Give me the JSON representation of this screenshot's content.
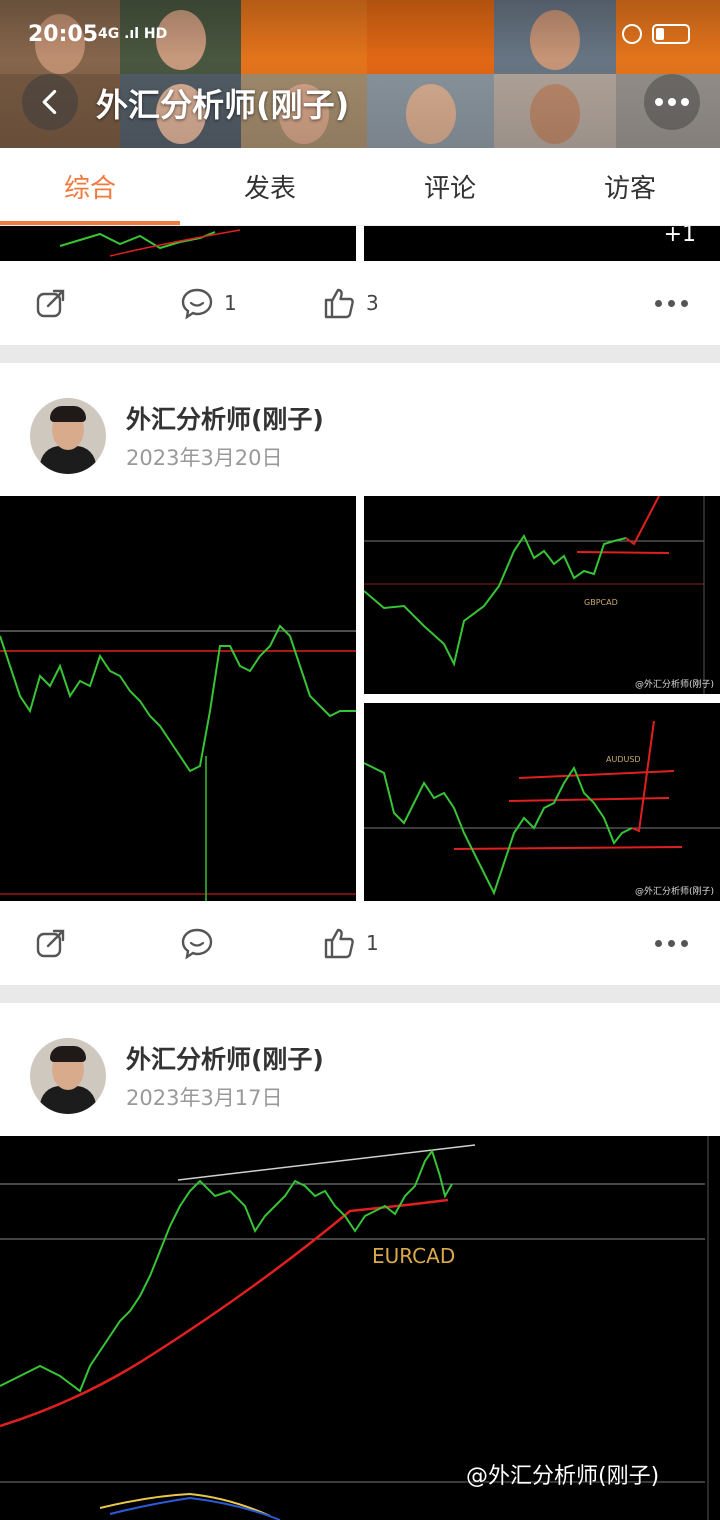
{
  "status_bar": {
    "time": "20:05",
    "network": "4G .ıl HD"
  },
  "header": {
    "title": "外汇分析师(刚子)"
  },
  "tabs": [
    {
      "label": "综合",
      "active": true
    },
    {
      "label": "发表",
      "active": false
    },
    {
      "label": "评论",
      "active": false
    },
    {
      "label": "访客",
      "active": false
    }
  ],
  "posts": [
    {
      "actions": {
        "comments": "1",
        "likes": "3"
      }
    },
    {
      "author": "外汇分析师(刚子)",
      "date": "2023年3月20日",
      "chart_labels": [
        "GBPCAD",
        "AUDUSD"
      ],
      "watermark": "@外汇分析师(刚子)",
      "actions": {
        "comments": "",
        "likes": "1"
      }
    },
    {
      "author": "外汇分析师(刚子)",
      "date": "2023年3月17日",
      "chart_labels": [
        "EURCAD"
      ],
      "watermark": "@外汇分析师(刚子)"
    }
  ],
  "colors": {
    "accent": "#ef7a3e",
    "candle": "#37c437",
    "ma_line": "#e02020",
    "divider": "#e9e9e9"
  }
}
